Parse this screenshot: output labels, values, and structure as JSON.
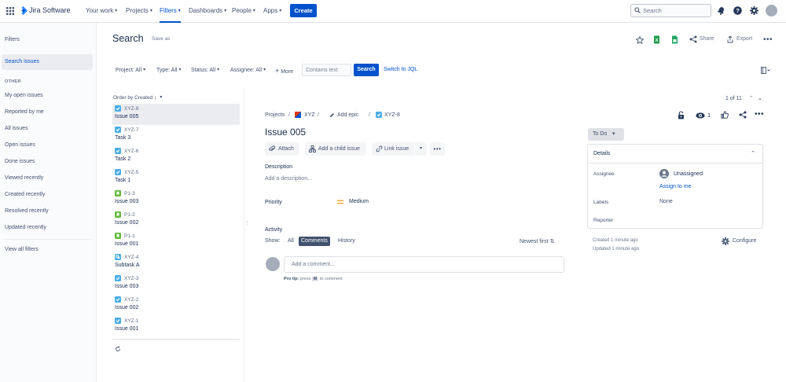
{
  "topnav": {
    "app_name": "Jira Software",
    "items": [
      "Your work",
      "Projects",
      "Filters",
      "Dashboards",
      "People",
      "Apps"
    ],
    "create_label": "Create",
    "search_placeholder": "Search"
  },
  "sidebar": {
    "title": "Filters",
    "active_item": "Search issues",
    "section_header": "OTHER",
    "items": [
      "My open issues",
      "Reported by me",
      "All issues",
      "Open issues",
      "Done issues",
      "Viewed recently",
      "Created recently",
      "Resolved recently",
      "Updated recently"
    ],
    "view_all": "View all filters"
  },
  "header": {
    "title": "Search",
    "save_as": "Save as",
    "share_label": "Share",
    "export_label": "Export"
  },
  "filters": {
    "project": "Project: All",
    "type": "Type: All",
    "status": "Status: All",
    "assignee": "Assignee: All",
    "more": "More",
    "contains_placeholder": "Contains text",
    "search_button": "Search",
    "switch_jql": "Switch to JQL"
  },
  "list": {
    "order_by": "Order by Created",
    "issues": [
      {
        "key": "XYZ-8",
        "summary": "Issue 005",
        "type": "task"
      },
      {
        "key": "XYZ-7",
        "summary": "Task 3",
        "type": "task"
      },
      {
        "key": "XYZ-6",
        "summary": "Task 2",
        "type": "task"
      },
      {
        "key": "XYZ-5",
        "summary": "Task 1",
        "type": "task"
      },
      {
        "key": "P1-3",
        "summary": "Issue 003",
        "type": "story"
      },
      {
        "key": "P1-2",
        "summary": "Issue 002",
        "type": "story"
      },
      {
        "key": "P1-1",
        "summary": "Issue 001",
        "type": "story"
      },
      {
        "key": "XYZ-4",
        "summary": "Subtask A",
        "type": "subtask"
      },
      {
        "key": "XYZ-3",
        "summary": "Issue 003",
        "type": "task"
      },
      {
        "key": "XYZ-2",
        "summary": "Issue 002",
        "type": "task"
      },
      {
        "key": "XYZ-1",
        "summary": "Issue 001",
        "type": "task"
      }
    ]
  },
  "detail": {
    "pager": "1 of 11",
    "breadcrumb": {
      "projects": "Projects",
      "project": "XYZ",
      "add_epic": "Add epic",
      "issue_key": "XYZ-8"
    },
    "watch_count": "1",
    "title": "Issue 005",
    "buttons": {
      "attach": "Attach",
      "add_child": "Add a child issue",
      "link_issue": "Link issue"
    },
    "description_label": "Description",
    "description_placeholder": "Add a description...",
    "priority_label": "Priority",
    "priority_value": "Medium",
    "activity": {
      "label": "Activity",
      "show": "Show:",
      "tabs": [
        "All",
        "Comments",
        "History"
      ],
      "active_tab": "Comments",
      "sort": "Newest first",
      "comment_placeholder": "Add a comment...",
      "pro_tip_prefix": "Pro tip:",
      "pro_tip_press": "press",
      "pro_tip_key": "M",
      "pro_tip_suffix": "to comment"
    },
    "status": "To Do",
    "details_panel": {
      "title": "Details",
      "assignee_label": "Assignee",
      "assignee_value": "Unassigned",
      "assign_to_me": "Assign to me",
      "labels_label": "Labels",
      "labels_value": "None",
      "reporter_label": "Reporter"
    },
    "created": "Created 1 minute ago",
    "updated": "Updated 1 minute ago",
    "configure": "Configure"
  },
  "colors": {
    "brand": "#0052cc",
    "text": "#172b4d",
    "subtle": "#6b778c",
    "task": "#4bade8",
    "story": "#63ba3c",
    "priority": "#ff991f"
  }
}
